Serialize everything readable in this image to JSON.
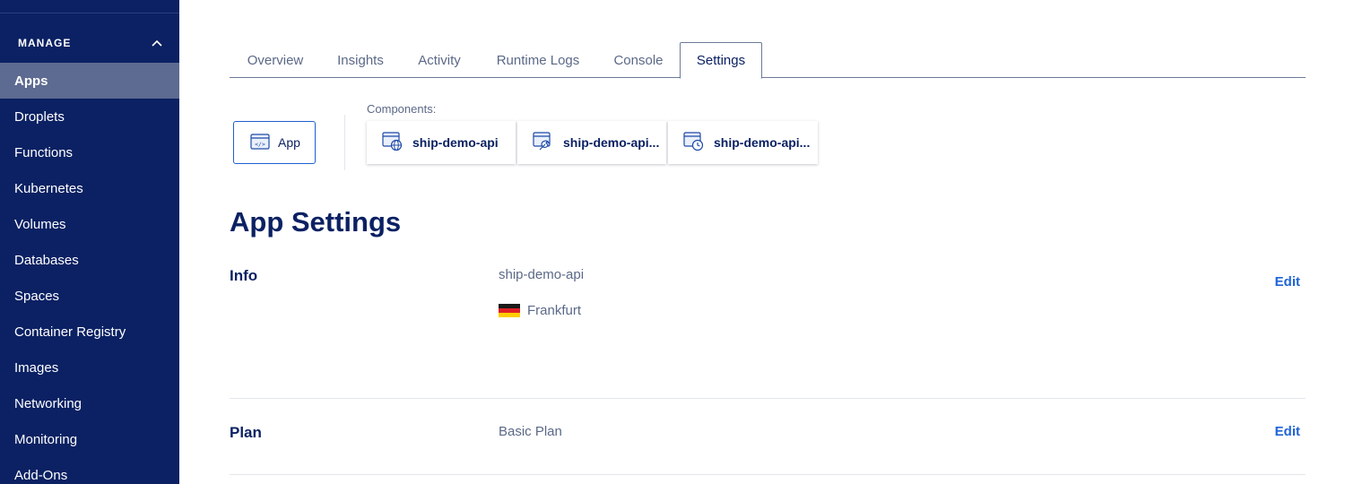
{
  "sidebar": {
    "section_title": "MANAGE",
    "items": [
      {
        "label": "Apps",
        "active": true
      },
      {
        "label": "Droplets"
      },
      {
        "label": "Functions"
      },
      {
        "label": "Kubernetes"
      },
      {
        "label": "Volumes"
      },
      {
        "label": "Databases"
      },
      {
        "label": "Spaces"
      },
      {
        "label": "Container Registry"
      },
      {
        "label": "Images"
      },
      {
        "label": "Networking"
      },
      {
        "label": "Monitoring"
      },
      {
        "label": "Add-Ons"
      }
    ]
  },
  "tabs": [
    "Overview",
    "Insights",
    "Activity",
    "Runtime Logs",
    "Console",
    "Settings"
  ],
  "active_tab": "Settings",
  "app_card": {
    "label": "App",
    "icon": "code-window-icon"
  },
  "components": {
    "label": "Components:",
    "items": [
      {
        "label": "ship-demo-api",
        "icon": "web-service-icon"
      },
      {
        "label": "ship-demo-api...",
        "icon": "worker-icon"
      },
      {
        "label": "ship-demo-api...",
        "icon": "job-icon"
      }
    ]
  },
  "page_title": "App Settings",
  "info": {
    "label": "Info",
    "app_name": "ship-demo-api",
    "region": "Frankfurt",
    "region_flag": "germany-flag",
    "edit_label": "Edit"
  },
  "plan": {
    "label": "Plan",
    "value": "Basic Plan",
    "edit_label": "Edit"
  },
  "colors": {
    "sidebar_bg": "#0b2163",
    "sidebar_active": "#5d6a91",
    "accent": "#1f63d6",
    "text_dark": "#0b2163",
    "text_muted": "#5b6987"
  }
}
